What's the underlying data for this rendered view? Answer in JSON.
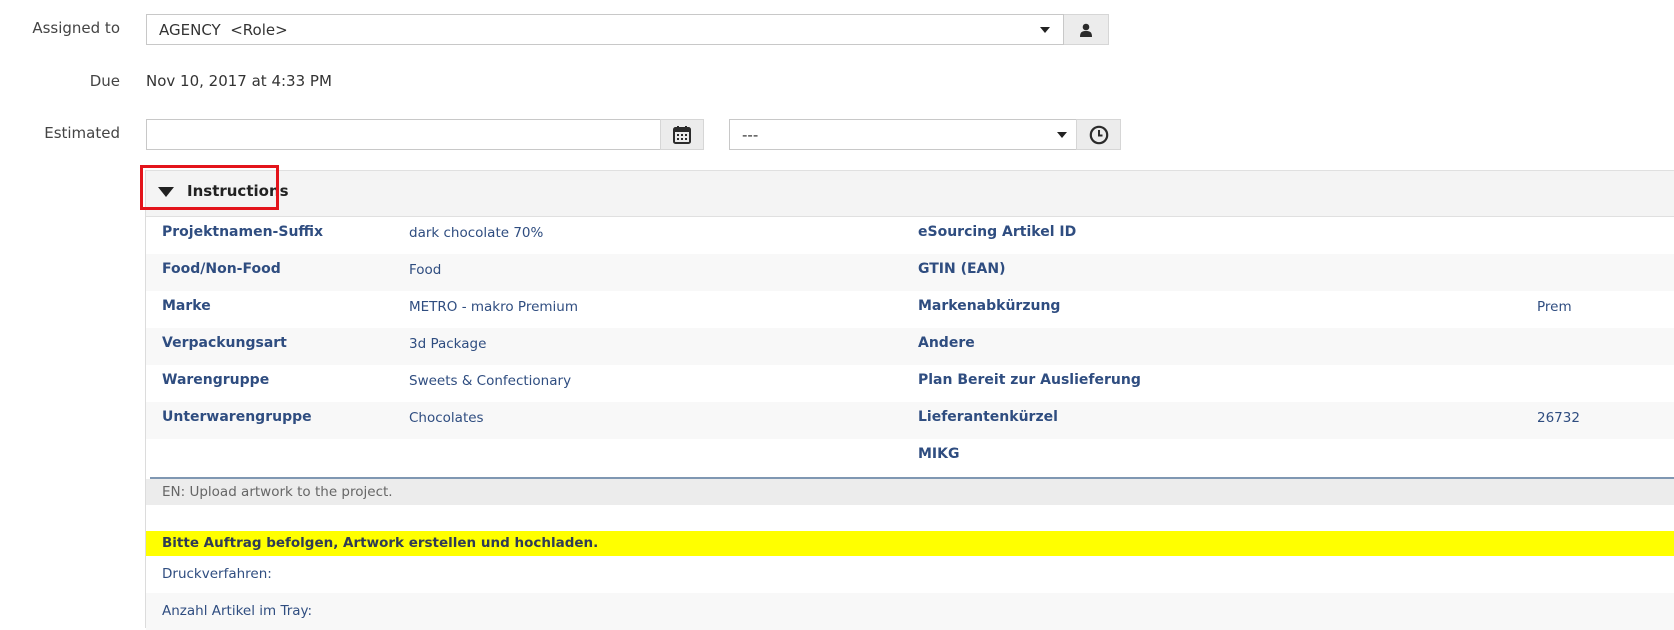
{
  "assigned": {
    "label": "Assigned to",
    "value": "AGENCY  <Role>",
    "user_icon": "user-icon",
    "caret_icon": "chevron-down-icon"
  },
  "due": {
    "label": "Due",
    "value": "Nov 10, 2017 at 4:33 PM"
  },
  "estimated": {
    "label": "Estimated",
    "date_value": "",
    "calendar_icon": "calendar-icon",
    "time_value": "---",
    "clock_icon": "clock-icon"
  },
  "instructions": {
    "title": "Instructions",
    "toggle_icon": "triangle-down-icon",
    "fields_left": [
      {
        "name": "Projektnamen-Suffix",
        "value": "dark chocolate 70%"
      },
      {
        "name": "Food/Non-Food",
        "value": "Food"
      },
      {
        "name": "Marke",
        "value": "METRO - makro Premium"
      },
      {
        "name": "Verpackungsart",
        "value": "3d Package"
      },
      {
        "name": "Warengruppe",
        "value": "Sweets & Confectionary"
      },
      {
        "name": "Unterwarengruppe",
        "value": "Chocolates"
      }
    ],
    "fields_right": [
      {
        "name": "eSourcing Artikel ID",
        "value": ""
      },
      {
        "name": "GTIN (EAN)",
        "value": ""
      },
      {
        "name": "Markenabkürzung",
        "value": "Prem"
      },
      {
        "name": "Andere",
        "value": ""
      },
      {
        "name": "Plan Bereit zur Auslieferung",
        "value": ""
      },
      {
        "name": "Lieferantenkürzel",
        "value": "26732"
      },
      {
        "name": "MIKG",
        "value": ""
      }
    ],
    "en_text": "EN: Upload artwork to the project.",
    "highlight_text": "Bitte Auftrag befolgen, Artwork erstellen und hochladen.",
    "notes": [
      "Druckverfahren:",
      "Anzahl Artikel im Tray:"
    ]
  },
  "colors": {
    "field_text": "#2f4d80",
    "highlight": "#ffff00",
    "callout_border": "#e3141b"
  }
}
